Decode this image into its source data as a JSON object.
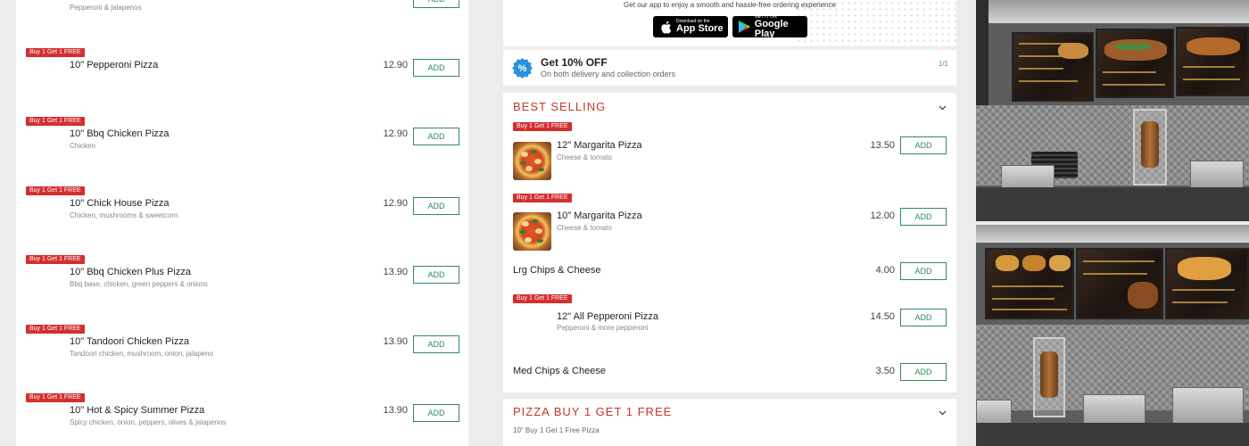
{
  "colors": {
    "promo_red": "#d32f2f",
    "add_green": "#2f8a5c",
    "section_red": "#c0392b",
    "offer_blue": "#2a91d8"
  },
  "left_menu": {
    "top_partial": {
      "desc": "Pepperoni & jalapenos",
      "add_label": "ADD"
    },
    "items": [
      {
        "badge": "Buy 1 Get 1 FREE",
        "name": "10\" Pepperoni Pizza",
        "desc": "",
        "price": "12.90",
        "add_label": "ADD"
      },
      {
        "badge": "Buy 1 Get 1 FREE",
        "name": "10\" Bbq Chicken Pizza",
        "desc": "Chicken",
        "price": "12.90",
        "add_label": "ADD"
      },
      {
        "badge": "Buy 1 Get 1 FREE",
        "name": "10\" Chick House Pizza",
        "desc": "Chicken, mushrooms & sweetcorn",
        "price": "12.90",
        "add_label": "ADD"
      },
      {
        "badge": "Buy 1 Get 1 FREE",
        "name": "10\" Bbq Chicken Plus Pizza",
        "desc": "Bbq base, chicken, green peppers & onions",
        "price": "13.90",
        "add_label": "ADD"
      },
      {
        "badge": "Buy 1 Get 1 FREE",
        "name": "10\" Tandoori Chicken Pizza",
        "desc": "Tandoori chicken, mushroom, onion, jalapeno",
        "price": "13.90",
        "add_label": "ADD"
      },
      {
        "badge": "Buy 1 Get 1 FREE",
        "name": "10\" Hot & Spicy Summer Pizza",
        "desc": "Spicy chicken, onion, peppers, olives & jalapenos",
        "price": "13.90",
        "add_label": "ADD"
      }
    ]
  },
  "app_banner": {
    "message": "Get our app to enjoy a smooth and hassle-free ordering experience",
    "app_store": {
      "small": "Download on the",
      "big": "App Store",
      "icon": "apple-icon"
    },
    "google_play": {
      "small": "GET IT ON",
      "big": "Google Play",
      "icon": "google-play-icon"
    }
  },
  "offer": {
    "icon": "discount-badge-icon",
    "title": "Get 10% OFF",
    "subtitle": "On both delivery and collection orders",
    "pager": "1/1"
  },
  "best_selling": {
    "title": "BEST SELLING",
    "items": [
      {
        "badge": "Buy 1 Get 1 FREE",
        "name": "12\" Margarita Pizza",
        "desc": "Cheese & tomato",
        "price": "13.50",
        "add_label": "ADD",
        "has_image": true
      },
      {
        "badge": "Buy 1 Get 1 FREE",
        "name": "10\" Margarita Pizza",
        "desc": "Cheese & tomato",
        "price": "12.00",
        "add_label": "ADD",
        "has_image": true
      },
      {
        "badge": "",
        "name": "Lrg Chips & Cheese",
        "desc": "",
        "price": "4.00",
        "add_label": "ADD",
        "has_image": false
      },
      {
        "badge": "Buy 1 Get 1 FREE",
        "name": "12\" All Pepperoni Pizza",
        "desc": "Pepperoni & more pepperoni",
        "price": "14.50",
        "add_label": "ADD",
        "has_image": false
      },
      {
        "badge": "",
        "name": "Med Chips & Cheese",
        "desc": "",
        "price": "3.50",
        "add_label": "ADD",
        "has_image": false
      }
    ]
  },
  "pizza_section": {
    "title": "PIZZA BUY 1 GET 1 FREE",
    "subtitle": "10\" Buy 1 Get 1 Free Pizza"
  }
}
